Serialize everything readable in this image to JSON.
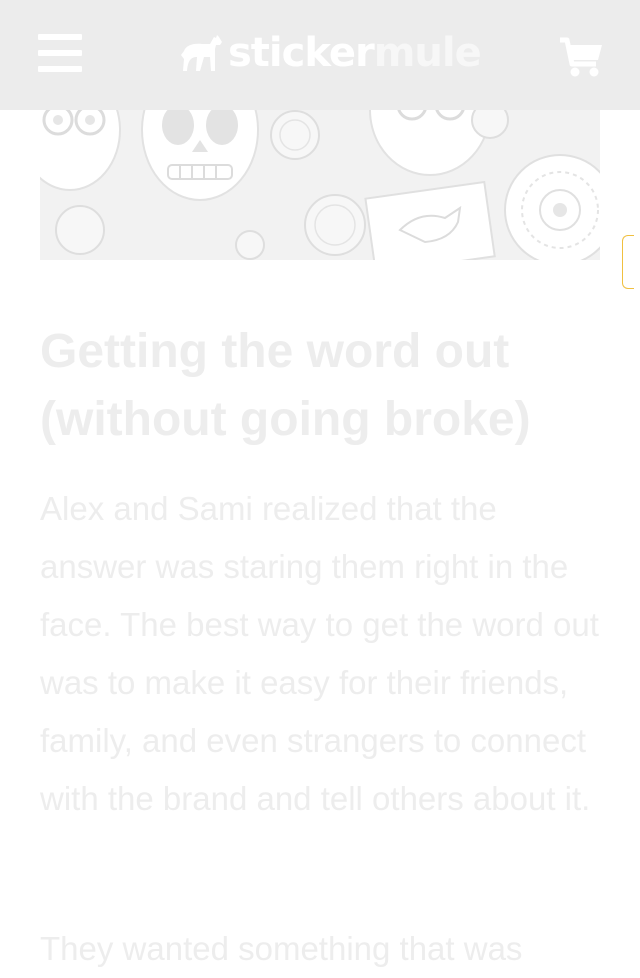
{
  "header": {
    "menu_icon": "hamburger-menu-icon",
    "logo": {
      "word1": "sticker",
      "word2": "mule",
      "icon": "mule-logo-icon"
    },
    "cart_icon": "shopping-cart-icon",
    "background": "#ececec"
  },
  "hero": {
    "description_icon": "sticker-collage-image"
  },
  "article": {
    "title": "Getting the word out (without going broke)",
    "paragraph1": "Alex and Sami realized that the answer was staring them right in the face. The best way to get the word out was to make it easy for their friends, family, and even strangers to connect with the brand and tell others about it.",
    "paragraph2": "They wanted something that was"
  },
  "colors": {
    "text_faded": "#ededed",
    "scroll_accent": "#f0c040"
  }
}
